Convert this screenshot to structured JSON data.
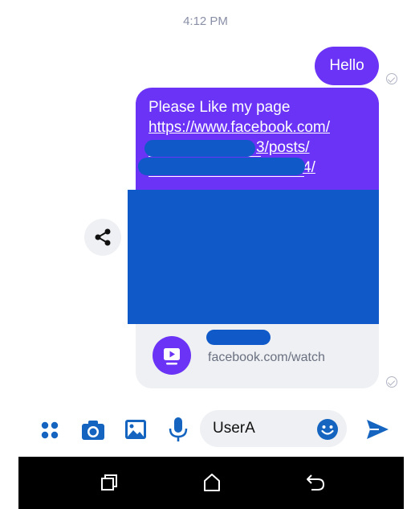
{
  "conversation": {
    "timestamp": "4:12 PM",
    "messages": [
      {
        "text": "Hello"
      },
      {
        "lines": [
          "Please Like my page",
          "https://www.facebook.com/",
          "3/posts/",
          "4/"
        ]
      }
    ],
    "link_preview": {
      "domain": "facebook.com/watch"
    }
  },
  "composer": {
    "input_value": "UserA"
  },
  "colors": {
    "accent": "#6a33f5",
    "composer_icons": "#1565c0",
    "redaction": "#1059c8"
  },
  "icons": [
    "apps-icon",
    "camera-icon",
    "gallery-icon",
    "mic-icon",
    "emoji-icon",
    "send-icon",
    "share-icon",
    "watch-icon",
    "recents-icon",
    "home-icon",
    "back-icon"
  ]
}
